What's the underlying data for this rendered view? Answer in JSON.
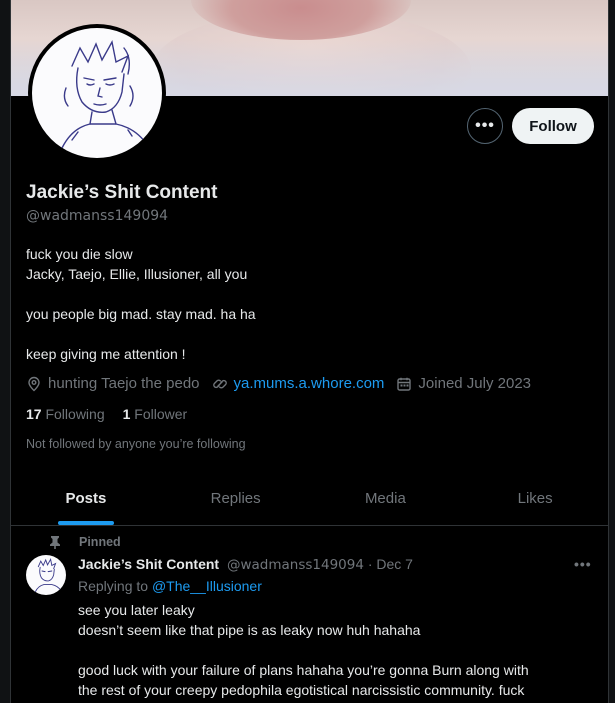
{
  "profile": {
    "name": "Jackie’s Shit Content",
    "handle": "@wadmanss149094",
    "bio_lines": [
      "fuck you die slow",
      "Jacky, Taejo, Ellie, Illusioner, all you",
      "",
      "you people big mad. stay mad. ha ha",
      "",
      "keep giving me attention !"
    ],
    "location": "hunting Taejo the pedo",
    "website": "ya.mums.a.whore.com",
    "joined": "Joined July 2023",
    "following_count": "17",
    "following_label": "Following",
    "followers_count": "1",
    "followers_label": "Follower",
    "not_followed_text": "Not followed by anyone you’re following"
  },
  "actions": {
    "more_label": "•••",
    "follow_label": "Follow"
  },
  "tabs": [
    {
      "label": "Posts",
      "active": true
    },
    {
      "label": "Replies",
      "active": false
    },
    {
      "label": "Media",
      "active": false
    },
    {
      "label": "Likes",
      "active": false
    }
  ],
  "post": {
    "pinned_label": "Pinned",
    "author_name": "Jackie’s Shit Content",
    "author_handle": "@wadmanss149094",
    "separator": "·",
    "date": "Dec 7",
    "more_label": "•••",
    "replying_prefix": "Replying to",
    "replying_to": "@The__Illusioner",
    "text_lines": [
      "see you later leaky",
      "doesn’t seem like that pipe is as leaky now huh hahaha",
      "",
      "good luck with your failure of plans hahaha you’re gonna Burn along with",
      "the rest of your creepy pedophila egotistical narcissistic community. fuck"
    ]
  },
  "colors": {
    "accent": "#1d9bf0",
    "background": "#000000",
    "text_primary": "#e7e9ea",
    "text_secondary": "#71767b",
    "border": "#2f3336"
  },
  "icons": [
    "more-icon",
    "location-icon",
    "link-icon",
    "calendar-icon",
    "pin-icon",
    "post-more-icon"
  ]
}
